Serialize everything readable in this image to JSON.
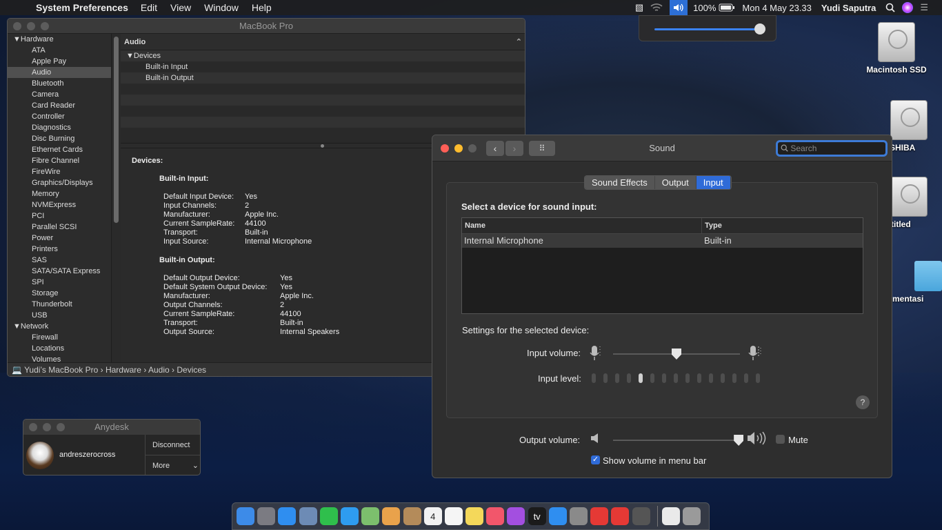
{
  "menubar": {
    "apple_icon": "",
    "app_name": "System Preferences",
    "menus": [
      "Edit",
      "View",
      "Window",
      "Help"
    ],
    "battery": "100%",
    "datetime": "Mon 4 May  23.33",
    "user": "Yudi Saputra"
  },
  "volume_popup": {
    "level": 0.97
  },
  "desktop": {
    "icons": [
      "Macintosh SSD",
      "SHIBA",
      "titled",
      "mentasi"
    ]
  },
  "sysinfo": {
    "title": "MacBook Pro",
    "sidebar": [
      {
        "label": "Hardware",
        "group": true
      },
      {
        "label": "ATA"
      },
      {
        "label": "Apple Pay"
      },
      {
        "label": "Audio",
        "selected": true
      },
      {
        "label": "Bluetooth"
      },
      {
        "label": "Camera"
      },
      {
        "label": "Card Reader"
      },
      {
        "label": "Controller"
      },
      {
        "label": "Diagnostics"
      },
      {
        "label": "Disc Burning"
      },
      {
        "label": "Ethernet Cards"
      },
      {
        "label": "Fibre Channel"
      },
      {
        "label": "FireWire"
      },
      {
        "label": "Graphics/Displays"
      },
      {
        "label": "Memory"
      },
      {
        "label": "NVMExpress"
      },
      {
        "label": "PCI"
      },
      {
        "label": "Parallel SCSI"
      },
      {
        "label": "Power"
      },
      {
        "label": "Printers"
      },
      {
        "label": "SAS"
      },
      {
        "label": "SATA/SATA Express"
      },
      {
        "label": "SPI"
      },
      {
        "label": "Storage"
      },
      {
        "label": "Thunderbolt"
      },
      {
        "label": "USB"
      },
      {
        "label": "Network",
        "group": true
      },
      {
        "label": "Firewall"
      },
      {
        "label": "Locations"
      },
      {
        "label": "Volumes"
      }
    ],
    "content_header": "Audio",
    "tree": {
      "parent": "Devices",
      "children": [
        "Built-in Input",
        "Built-in Output"
      ]
    },
    "detail": {
      "heading": "Devices:",
      "input": {
        "title": "Built-in Input:",
        "rows": [
          {
            "k": "Default Input Device:",
            "v": "Yes"
          },
          {
            "k": "Input Channels:",
            "v": "2"
          },
          {
            "k": "Manufacturer:",
            "v": "Apple Inc."
          },
          {
            "k": "Current SampleRate:",
            "v": "44100"
          },
          {
            "k": "Transport:",
            "v": "Built-in"
          },
          {
            "k": "Input Source:",
            "v": "Internal Microphone"
          }
        ]
      },
      "output": {
        "title": "Built-in Output:",
        "rows": [
          {
            "k": "Default Output Device:",
            "v": "Yes"
          },
          {
            "k": "Default System Output Device:",
            "v": "Yes"
          },
          {
            "k": "Manufacturer:",
            "v": "Apple Inc."
          },
          {
            "k": "Output Channels:",
            "v": "2"
          },
          {
            "k": "Current SampleRate:",
            "v": "44100"
          },
          {
            "k": "Transport:",
            "v": "Built-in"
          },
          {
            "k": "Output Source:",
            "v": "Internal Speakers"
          }
        ]
      }
    },
    "pathbar": [
      "Yudi’s MacBook Pro",
      "Hardware",
      "Audio",
      "Devices"
    ]
  },
  "sound": {
    "title": "Sound",
    "search_placeholder": "Search",
    "tabs": [
      {
        "label": "Sound Effects"
      },
      {
        "label": "Output"
      },
      {
        "label": "Input",
        "active": true
      }
    ],
    "select_heading": "Select a device for sound input:",
    "table": {
      "headers": [
        "Name",
        "Type"
      ],
      "rows": [
        {
          "name": "Internal Microphone",
          "type": "Built-in"
        }
      ]
    },
    "settings_heading": "Settings for the selected device:",
    "input_volume_label": "Input volume:",
    "input_volume": 0.5,
    "input_level_label": "Input level:",
    "input_level_segments": 15,
    "input_level_lit": 1,
    "help": "?",
    "output_volume_label": "Output volume:",
    "output_volume": 0.99,
    "mute_label": "Mute",
    "mute_checked": false,
    "show_volume_label": "Show volume in menu bar",
    "show_volume_checked": true
  },
  "anydesk": {
    "title": "Anydesk",
    "user": "andreszerocross",
    "disconnect": "Disconnect",
    "more": "More"
  },
  "dock": {
    "apps": [
      {
        "name": "finder-icon",
        "color": "#3d8be8"
      },
      {
        "name": "launchpad-icon",
        "color": "#7b7b82"
      },
      {
        "name": "safari-icon",
        "color": "#2f8ef0"
      },
      {
        "name": "preview-icon",
        "color": "#6d8bb5"
      },
      {
        "name": "facetime-icon",
        "color": "#2fbf4c"
      },
      {
        "name": "messages-icon",
        "color": "#2e9cf0"
      },
      {
        "name": "maps-icon",
        "color": "#7cbf6d"
      },
      {
        "name": "photos-icon",
        "color": "#e9a24b"
      },
      {
        "name": "contacts-icon",
        "color": "#b48b5a"
      },
      {
        "name": "calendar-icon",
        "color": "#f2f2f2",
        "text": "4"
      },
      {
        "name": "reminders-icon",
        "color": "#f5f5f5"
      },
      {
        "name": "notes-icon",
        "color": "#f4d85a"
      },
      {
        "name": "music-icon",
        "color": "#f2566b"
      },
      {
        "name": "podcasts-icon",
        "color": "#a34fe0"
      },
      {
        "name": "tv-icon",
        "color": "#1b1b1b",
        "text": "tv"
      },
      {
        "name": "app-store-icon",
        "color": "#2f8ef0"
      },
      {
        "name": "system-preferences-icon",
        "color": "#8a8a8a"
      },
      {
        "name": "anydesk-icon",
        "color": "#e53935"
      },
      {
        "name": "anydesk-alt-icon",
        "color": "#e53935"
      },
      {
        "name": "network-icon",
        "color": "#555"
      }
    ],
    "after_sep": [
      {
        "name": "document-icon",
        "color": "#eaeaea"
      },
      {
        "name": "trash-icon",
        "color": "#9a9a9a"
      }
    ]
  }
}
